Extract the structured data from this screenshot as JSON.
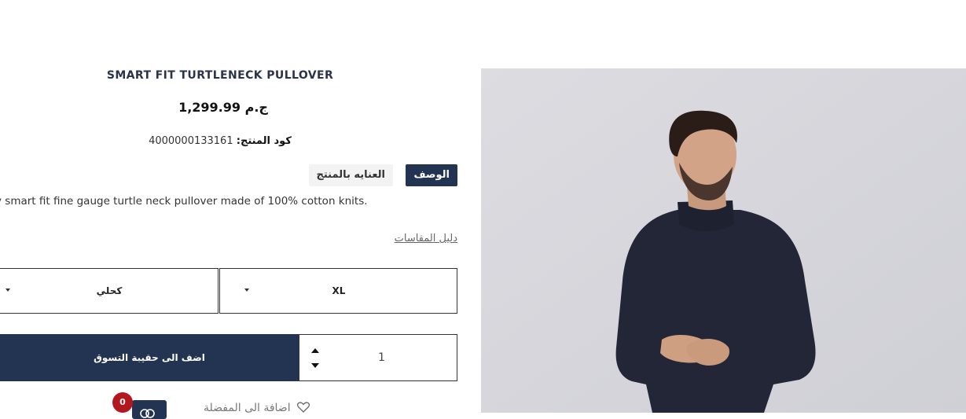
{
  "product": {
    "title": "SMART FIT TURTLENECK PULLOVER",
    "price": "ج.م 1,299.99",
    "sku_label": "كود المنتج:",
    "sku_value": "4000000133161"
  },
  "tabs": {
    "description": "الوصف",
    "care": "العنايه بالمنتج"
  },
  "description_text": "y smart fit fine gauge turtle neck pullover made of 100% cotton knits.",
  "size_guide": "دليل المقاسات",
  "selects": {
    "size": "XL",
    "color": "كحلي"
  },
  "quantity": "1",
  "add_to_cart": "اضف الى حقيبة التسوق",
  "wishlist_label": "اضافة الى المفضلة",
  "cart_badge": "0",
  "colors": {
    "accent": "#233352",
    "badge": "#b3161c"
  },
  "icons": {
    "heart": "heart-icon",
    "cart": "cart-icon"
  }
}
